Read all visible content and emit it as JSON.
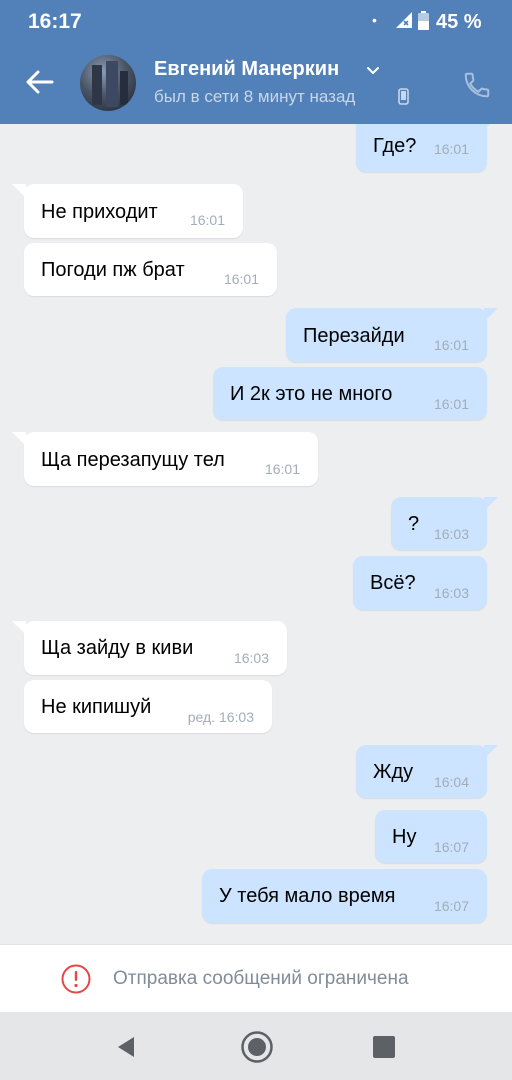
{
  "status_bar": {
    "time": "16:17",
    "dot": "•",
    "battery_percent": "45 %",
    "icons": [
      "signal-icon",
      "battery-icon"
    ]
  },
  "header": {
    "contact_name": "Евгений Манеркин",
    "status": "был в сети 8 минут назад",
    "icons": [
      "back-arrow-icon",
      "chevron-down-icon",
      "mobile-phone-icon",
      "phone-call-icon"
    ],
    "colors": {
      "bar": "#5181b8",
      "status_text": "#c8d7ea"
    }
  },
  "messages": [
    {
      "direction": "out",
      "text": "Где?",
      "time": "16:01"
    },
    {
      "direction": "in",
      "text": "Не приходит",
      "time": "16:01"
    },
    {
      "direction": "in",
      "text": "Погоди пж брат",
      "time": "16:01"
    },
    {
      "direction": "out",
      "text": "Перезайди",
      "time": "16:01"
    },
    {
      "direction": "out",
      "text": "И 2к это не много",
      "time": "16:01"
    },
    {
      "direction": "in",
      "text": "Ща перезапущу тел",
      "time": "16:01"
    },
    {
      "direction": "out",
      "text": "?",
      "time": "16:03"
    },
    {
      "direction": "out",
      "text": "Всё?",
      "time": "16:03"
    },
    {
      "direction": "in",
      "text": "Ща зайду в киви",
      "time": "16:03"
    },
    {
      "direction": "in",
      "text": "Не кипишуй",
      "time": "ред. 16:03"
    },
    {
      "direction": "out",
      "text": "Жду",
      "time": "16:04"
    },
    {
      "direction": "out",
      "text": "Ну",
      "time": "16:07"
    },
    {
      "direction": "out",
      "text": "У тебя мало время",
      "time": "16:07"
    }
  ],
  "bubble_colors": {
    "incoming": "#ffffff",
    "outgoing": "#cce4ff",
    "chat_background": "#edeef0"
  },
  "restriction": {
    "text": "Отправка сообщений ограничена",
    "icon": "warning-circle-icon",
    "icon_color": "#e64646"
  },
  "nav_bar": {
    "icons": [
      "nav-back-icon",
      "nav-home-icon",
      "nav-recents-icon"
    ]
  }
}
